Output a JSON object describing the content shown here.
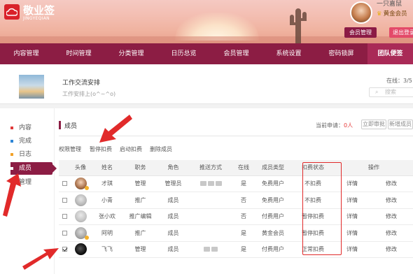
{
  "app": {
    "name": "敬业签",
    "subtitle": "JINGYEQIAN"
  },
  "user": {
    "name": "一只嘉鼠",
    "level": "黄金会员",
    "member_btn": "会员管理",
    "logout_btn": "退出登录"
  },
  "nav": [
    "内容管理",
    "时间管理",
    "分类管理",
    "日历总览",
    "会员管理",
    "系统设置",
    "密码锁屏",
    "团队便签"
  ],
  "team": {
    "title": "工作交流安排",
    "desc": "工作安排上(o^~^o)",
    "online": "在线：3/5",
    "search_placeholder": "搜索"
  },
  "sidebar": [
    {
      "label": "内容",
      "color": "#e03a3a"
    },
    {
      "label": "完成",
      "color": "#2e86d6"
    },
    {
      "label": "日志",
      "color": "#f2a128"
    },
    {
      "label": "成员",
      "color": "#ffffff"
    },
    {
      "label": "管理",
      "color": "#2db56b"
    }
  ],
  "main": {
    "title": "成员",
    "apply_label": "当前申请：",
    "apply_count": "0人",
    "review_btn": "立即审批",
    "new_member_btn": "新增成员",
    "toolbar": [
      "权限管理",
      "暂停扣费",
      "启动扣费",
      "删除成员"
    ]
  },
  "table": {
    "headers": [
      "头像",
      "姓名",
      "职务",
      "角色",
      "推送方式",
      "在线",
      "成员类型",
      "扣费状态",
      "操作"
    ],
    "rows": [
      {
        "name": "才琪",
        "job": "管理",
        "role": "管理员",
        "online": "是",
        "type": "免费用户",
        "fee": "不扣费",
        "detail": "详情",
        "edit": "修改",
        "checked": false
      },
      {
        "name": "小青",
        "job": "推广",
        "role": "成员",
        "online": "否",
        "type": "免费用户",
        "fee": "不扣费",
        "detail": "详情",
        "edit": "修改",
        "checked": false
      },
      {
        "name": "张小欢",
        "job": "推广编辑",
        "role": "成员",
        "online": "否",
        "type": "付费用户",
        "fee": "暂停扣费",
        "detail": "详情",
        "edit": "修改",
        "checked": false
      },
      {
        "name": "阿明",
        "job": "推广",
        "role": "成员",
        "online": "是",
        "type": "黄金会员",
        "fee": "暂停扣费",
        "detail": "详情",
        "edit": "修改",
        "checked": false
      },
      {
        "name": "飞飞",
        "job": "管理",
        "role": "成员",
        "online": "是",
        "type": "付费用户",
        "fee": "正常扣费",
        "detail": "详情",
        "edit": "修改",
        "checked": true
      }
    ]
  },
  "colors": {
    "brand": "#8c1d44",
    "accent": "#e34a69",
    "highlight": "#e12a2a"
  }
}
